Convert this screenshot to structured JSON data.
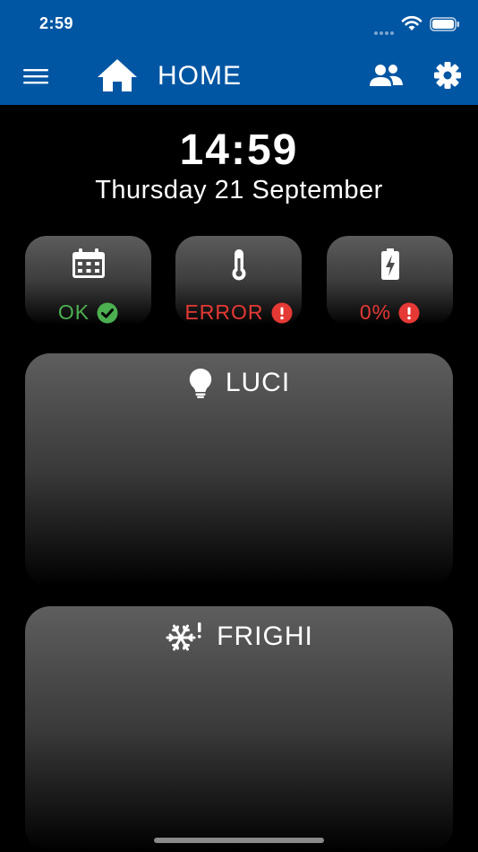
{
  "status_bar": {
    "time": "2:59"
  },
  "app_bar": {
    "title": "HOME"
  },
  "clock": {
    "time": "14:59",
    "date": "Thursday 21 September"
  },
  "status_cards": [
    {
      "icon": "calendar-icon",
      "status": "OK",
      "state": "ok"
    },
    {
      "icon": "thermometer-icon",
      "status": "ERROR",
      "state": "error"
    },
    {
      "icon": "battery-charging-icon",
      "status": "0%",
      "state": "error"
    }
  ],
  "panels": [
    {
      "icon": "lightbulb-icon",
      "label": "LUCI"
    },
    {
      "icon": "snowflake-icon",
      "label": "FRIGHI"
    }
  ],
  "colors": {
    "primary": "#0056a3",
    "ok": "#4caf50",
    "error": "#e53935",
    "background": "#000000"
  }
}
